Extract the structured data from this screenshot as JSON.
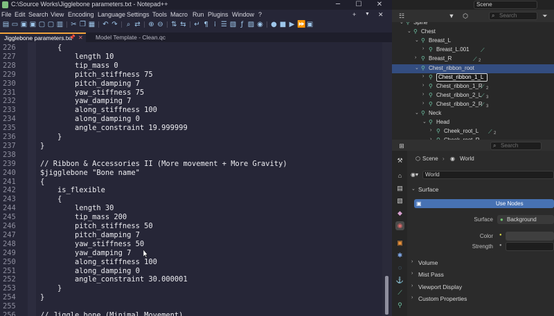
{
  "notepad": {
    "title": "C:\\Source Works\\Jigglebone parameters.txt - Notepad++",
    "menu": [
      "File",
      "Edit",
      "Search",
      "View",
      "Encoding",
      "Language",
      "Settings",
      "Tools",
      "Macro",
      "Run",
      "Plugins",
      "Window",
      "?"
    ],
    "window_controls": {
      "minimize": "─",
      "maximize": "☐",
      "close": "✕"
    },
    "menu_right": {
      "add": "+",
      "drop": "▼",
      "close": "✕"
    },
    "tabs": [
      {
        "label": "Jigglebone parameters.txt",
        "pin": "📌",
        "close": "✕",
        "active": true
      },
      {
        "label": "Model Template - Clean.qc",
        "active": false
      }
    ],
    "lines": [
      {
        "n": "226",
        "text": "    {"
      },
      {
        "n": "227",
        "text": "        length 10"
      },
      {
        "n": "228",
        "text": "        tip_mass 0"
      },
      {
        "n": "229",
        "text": "        pitch_stiffness 75"
      },
      {
        "n": "230",
        "text": "        pitch_damping 7"
      },
      {
        "n": "231",
        "text": "        yaw_stiffness 75"
      },
      {
        "n": "232",
        "text": "        yaw_damping 7"
      },
      {
        "n": "233",
        "text": "        along_stiffness 100"
      },
      {
        "n": "234",
        "text": "        along_damping 0"
      },
      {
        "n": "235",
        "text": "        angle_constraint 19.999999"
      },
      {
        "n": "236",
        "text": "    }"
      },
      {
        "n": "237",
        "text": "}"
      },
      {
        "n": "238",
        "text": ""
      },
      {
        "n": "239",
        "text": "// Ribbon & Accessories II (More movement + More Gravity)"
      },
      {
        "n": "240",
        "text": "$jigglebone \"Bone name\""
      },
      {
        "n": "241",
        "text": "{"
      },
      {
        "n": "242",
        "text": "    is_flexible"
      },
      {
        "n": "243",
        "text": "    {"
      },
      {
        "n": "244",
        "text": "        length 30"
      },
      {
        "n": "245",
        "text": "        tip_mass 200"
      },
      {
        "n": "246",
        "text": "        pitch_stiffness 50"
      },
      {
        "n": "247",
        "text": "        pitch_damping 7"
      },
      {
        "n": "248",
        "text": "        yaw_stiffness 50"
      },
      {
        "n": "249",
        "text": "        yaw_damping 7"
      },
      {
        "n": "250",
        "text": "        along_stiffness 100"
      },
      {
        "n": "251",
        "text": "        along_damping 0"
      },
      {
        "n": "252",
        "text": "        angle_constraint 30.000001"
      },
      {
        "n": "253",
        "text": "    }"
      },
      {
        "n": "254",
        "text": "}"
      },
      {
        "n": "255",
        "text": ""
      },
      {
        "n": "256",
        "text": "// Jiggle bone (Minimal Movement)"
      }
    ]
  },
  "blender": {
    "outliner": {
      "scene_label": "Scene",
      "search_placeholder": "Search",
      "rows": [
        {
          "label": "Spine",
          "indent": 7,
          "arrow": "⌄",
          "bone": true
        },
        {
          "label": "Chest",
          "indent": 8,
          "arrow": "⌄",
          "bone": true
        },
        {
          "label": "Breast_L",
          "indent": 9,
          "arrow": "⌄",
          "bone": true
        },
        {
          "label": "Breast_L.001",
          "indent": 10,
          "arrow": "›",
          "bone": true,
          "extra": "⟋",
          "sub": ""
        },
        {
          "label": "Breast_R",
          "indent": 9,
          "arrow": "›",
          "bone": true,
          "extra": "⟋",
          "sub": "2"
        },
        {
          "label": "Chest_ribbon_root",
          "indent": 9,
          "arrow": "⌄",
          "bone": true,
          "selected": true
        },
        {
          "label": "Chest_ribbon_1_L",
          "indent": 10,
          "arrow": "›",
          "bone": true,
          "editing": true
        },
        {
          "label": "Chest_ribbon_1_R",
          "indent": 10,
          "arrow": "›",
          "bone": true,
          "extra": "⟋",
          "sub": "2"
        },
        {
          "label": "Chest_ribbon_2_L",
          "indent": 10,
          "arrow": "›",
          "bone": true,
          "extra": "⟋",
          "sub": "3"
        },
        {
          "label": "Chest_ribbon_2_R",
          "indent": 10,
          "arrow": "›",
          "bone": true,
          "extra": "⟋",
          "sub": "3"
        },
        {
          "label": "Neck",
          "indent": 9,
          "arrow": "⌄",
          "bone": true
        },
        {
          "label": "Head",
          "indent": 10,
          "arrow": "⌄",
          "bone": true
        },
        {
          "label": "Cheek_root_L",
          "indent": 11,
          "arrow": "›",
          "bone": true,
          "extra": "⟋",
          "sub": "2"
        },
        {
          "label": "Cheek_root_R",
          "indent": 11,
          "arrow": "›",
          "bone": true
        }
      ]
    },
    "properties": {
      "search_placeholder": "Search",
      "breadcrumb": {
        "scene": "Scene",
        "separator": "›",
        "world": "World"
      },
      "world_field": "World",
      "surface_title": "Surface",
      "use_nodes": "Use Nodes",
      "surface_label": "Surface",
      "surface_value": "Background",
      "color_label": "Color",
      "strength_label": "Strength",
      "collapsed_sections": [
        "Volume",
        "Mist Pass",
        "Viewport Display",
        "Custom Properties"
      ]
    }
  },
  "colors": {
    "npp_bg": "#262637",
    "tab_accent": "#f2a33a",
    "blender_selection": "#334d80",
    "use_nodes_blue": "#4772b3",
    "bone_green": "#6fc3a4"
  }
}
